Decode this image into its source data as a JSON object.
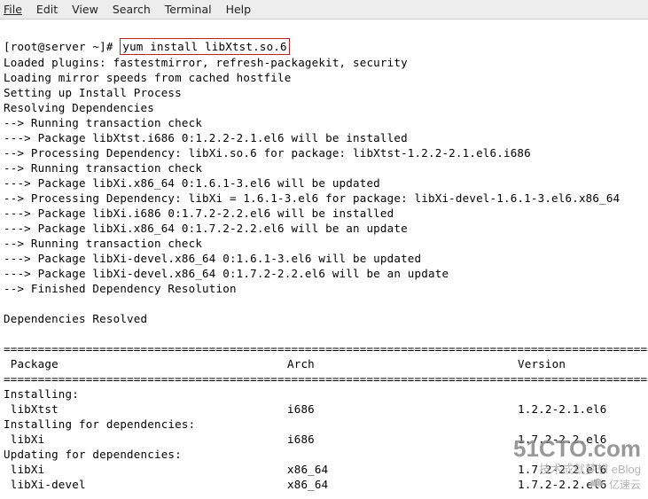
{
  "menu": {
    "file": "File",
    "edit": "Edit",
    "view": "View",
    "search": "Search",
    "terminal": "Terminal",
    "help": "Help"
  },
  "prompt": "[root@server ~]# ",
  "command": "yum install libXtst.so.6",
  "output_lines": [
    "Loaded plugins: fastestmirror, refresh-packagekit, security",
    "Loading mirror speeds from cached hostfile",
    "Setting up Install Process",
    "Resolving Dependencies",
    "--> Running transaction check",
    "---> Package libXtst.i686 0:1.2.2-2.1.el6 will be installed",
    "--> Processing Dependency: libXi.so.6 for package: libXtst-1.2.2-2.1.el6.i686",
    "--> Running transaction check",
    "---> Package libXi.x86_64 0:1.6.1-3.el6 will be updated",
    "--> Processing Dependency: libXi = 1.6.1-3.el6 for package: libXi-devel-1.6.1-3.el6.x86_64",
    "---> Package libXi.i686 0:1.7.2-2.2.el6 will be installed",
    "---> Package libXi.x86_64 0:1.7.2-2.2.el6 will be an update",
    "--> Running transaction check",
    "---> Package libXi-devel.x86_64 0:1.6.1-3.el6 will be updated",
    "---> Package libXi-devel.x86_64 0:1.7.2-2.2.el6 will be an update",
    "--> Finished Dependency Resolution",
    "",
    "Dependencies Resolved",
    ""
  ],
  "rule": "================================================================================================",
  "columns": {
    "package": " Package",
    "arch": "Arch",
    "version": "Version"
  },
  "sections": {
    "installing": "Installing:",
    "installing_deps": "Installing for dependencies:",
    "updating_deps": "Updating for dependencies:"
  },
  "rows": {
    "r1": {
      "name": " libXtst",
      "arch": "i686",
      "version": "1.2.2-2.1.el6"
    },
    "r2": {
      "name": " libXi",
      "arch": "i686",
      "version": "1.7.2-2.2.el6"
    },
    "r3": {
      "name": " libXi",
      "arch": "x86_64",
      "version": "1.7.2-2.2.el6"
    },
    "r4": {
      "name": " libXi-devel",
      "arch": "x86_64",
      "version": "1.7.2-2.2.el6"
    }
  },
  "watermark": {
    "line1": "51CTO.com",
    "line2": "技术成就梦想   eBlog",
    "line3": "亿速云"
  }
}
